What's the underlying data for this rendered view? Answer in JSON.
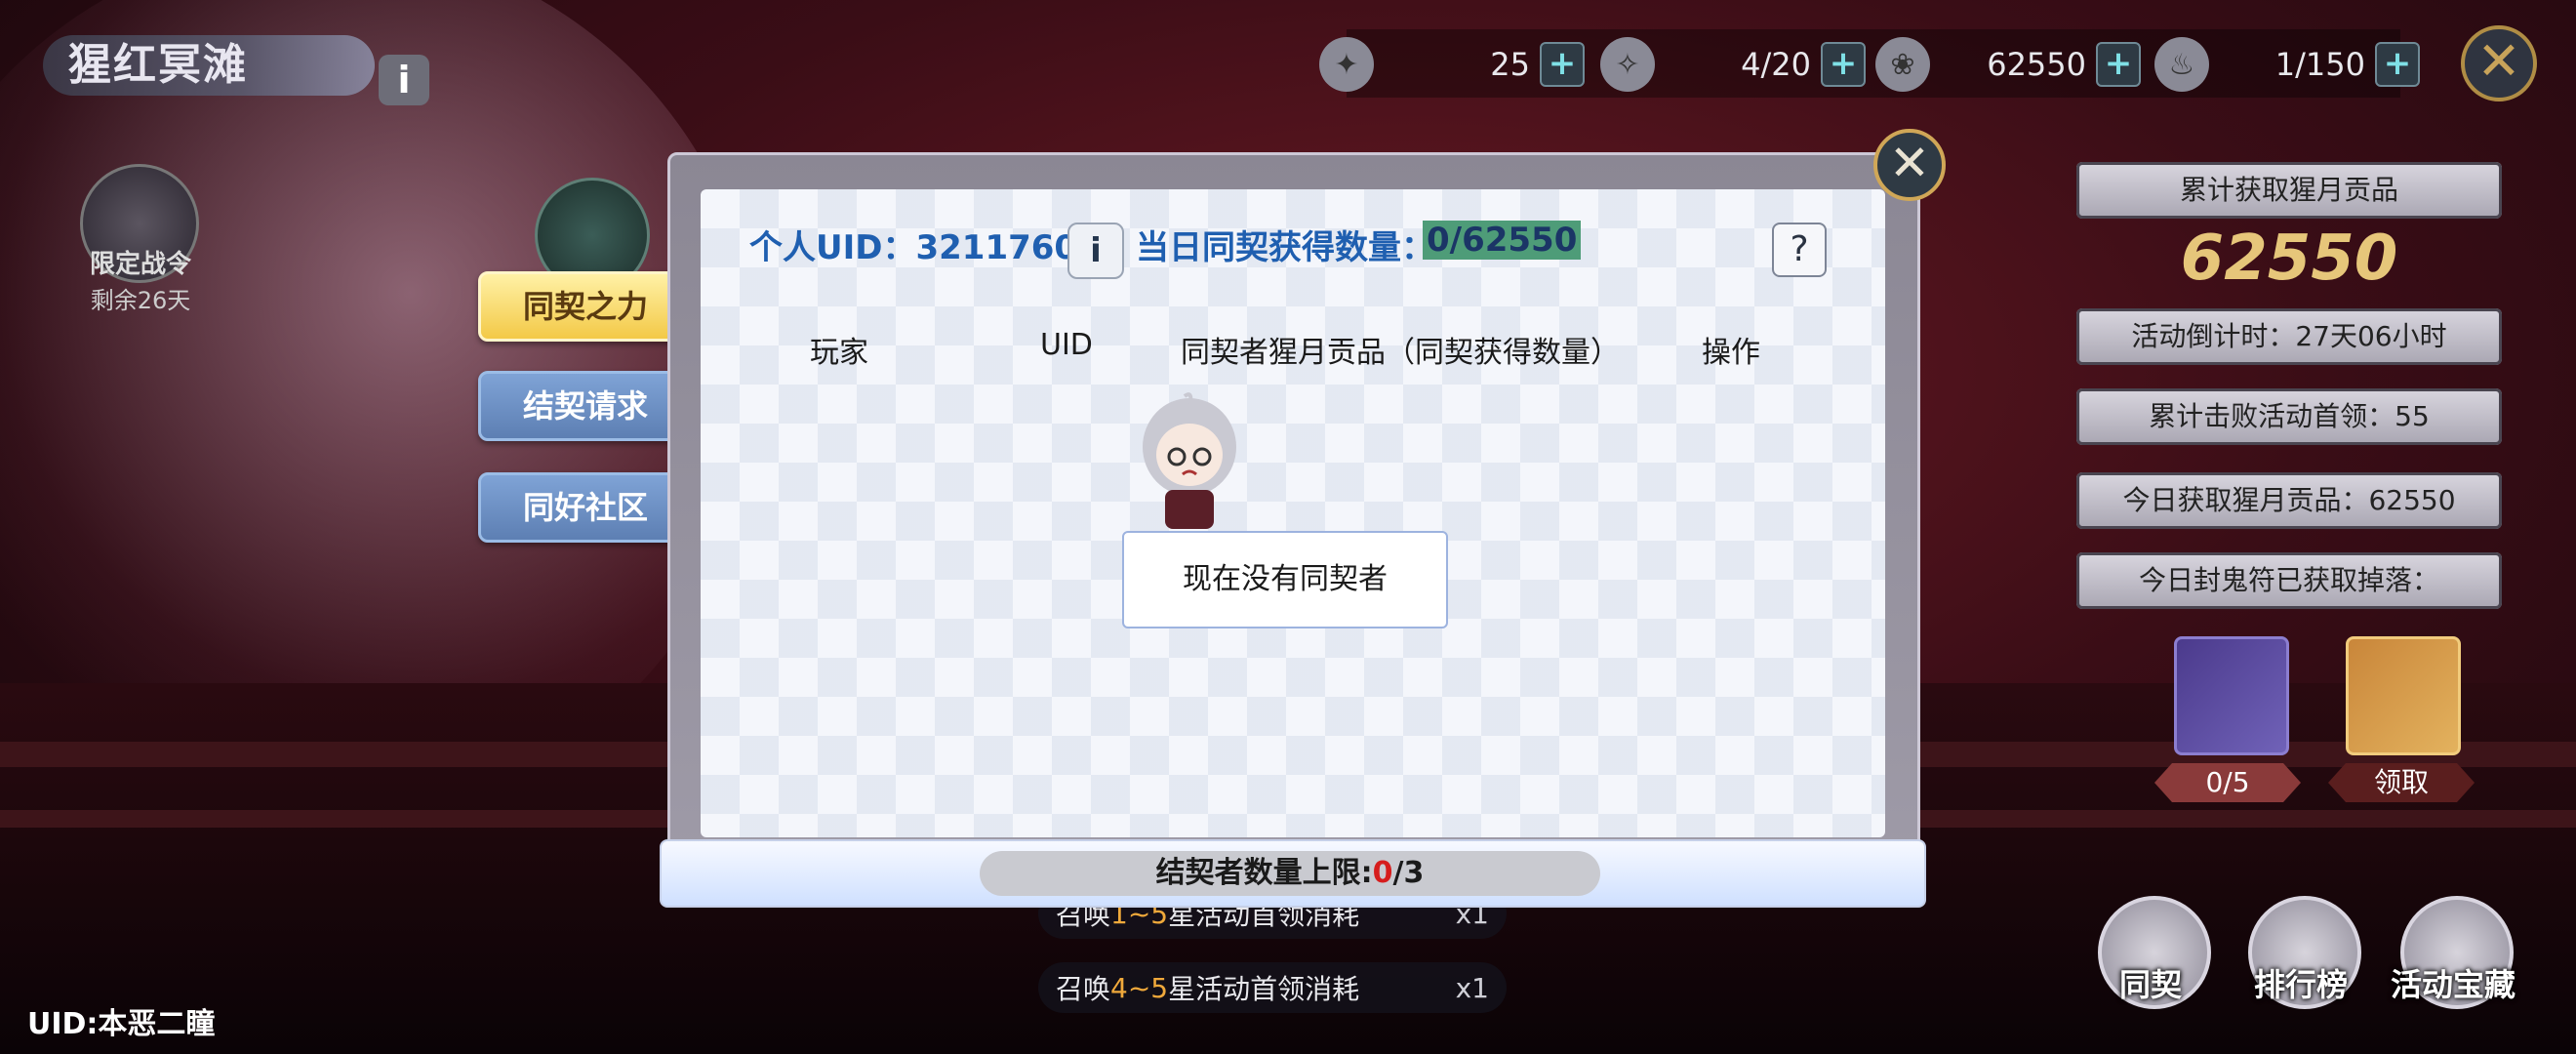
{
  "event": {
    "title": "猩红冥滩",
    "pass_label": "限定战令",
    "pass_remaining": "剩余26天",
    "player_uid_label": "UID:本恶二瞳"
  },
  "resources": [
    {
      "icon": "sealed-talisman-icon",
      "value": "25"
    },
    {
      "icon": "ticket-icon",
      "value": "4/20"
    },
    {
      "icon": "lotus-icon",
      "value": "62550"
    },
    {
      "icon": "drumstick-icon",
      "value": "1/150"
    }
  ],
  "stats": {
    "total_tribute_label": "累计获取猩月贡品",
    "total_tribute_value": "62550",
    "countdown": "活动倒计时：27天06小时",
    "bosses_defeated": "累计击败活动首领：55",
    "today_tribute": "今日获取猩月贡品：62550",
    "today_talisman": "今日封鬼符已获取掉落："
  },
  "rewards": [
    {
      "tag": "0/5",
      "color": "#7062b8"
    },
    {
      "tag": "领取",
      "color": "#e3b25e"
    }
  ],
  "bottom_buttons": [
    {
      "label": "同契",
      "icon": "person-icon"
    },
    {
      "label": "排行榜",
      "icon": "trophy-icon"
    },
    {
      "label": "活动宝藏",
      "icon": "chest-icon"
    }
  ],
  "tasks": [
    {
      "prefix": "召唤",
      "range": "1~5",
      "suffix": "星活动首领消耗",
      "cost": "x1"
    },
    {
      "prefix": "召唤",
      "range": "4~5",
      "suffix": "星活动首领消耗",
      "cost": "x1"
    }
  ],
  "side_tabs": [
    {
      "label": "同契之力",
      "active": true
    },
    {
      "label": "结契请求",
      "active": false
    },
    {
      "label": "同好社区",
      "active": false
    }
  ],
  "modal": {
    "personal_uid": "个人UID：3211760",
    "daily_label": "当日同契获得数量：",
    "daily_current": "0",
    "daily_max": "/62550",
    "columns": [
      "玩家",
      "UID",
      "同契者猩月贡品（同契获得数量）",
      "操作"
    ],
    "empty_message": "现在没有同契者",
    "limit_label": "结契者数量上限:",
    "limit_current": "0",
    "limit_max": "/3"
  },
  "colors": {
    "accent_blue": "#1f5fb0",
    "active_tab": "#f3c947",
    "idle_tab": "#5d7fb3",
    "gold": "#e6c67a"
  }
}
